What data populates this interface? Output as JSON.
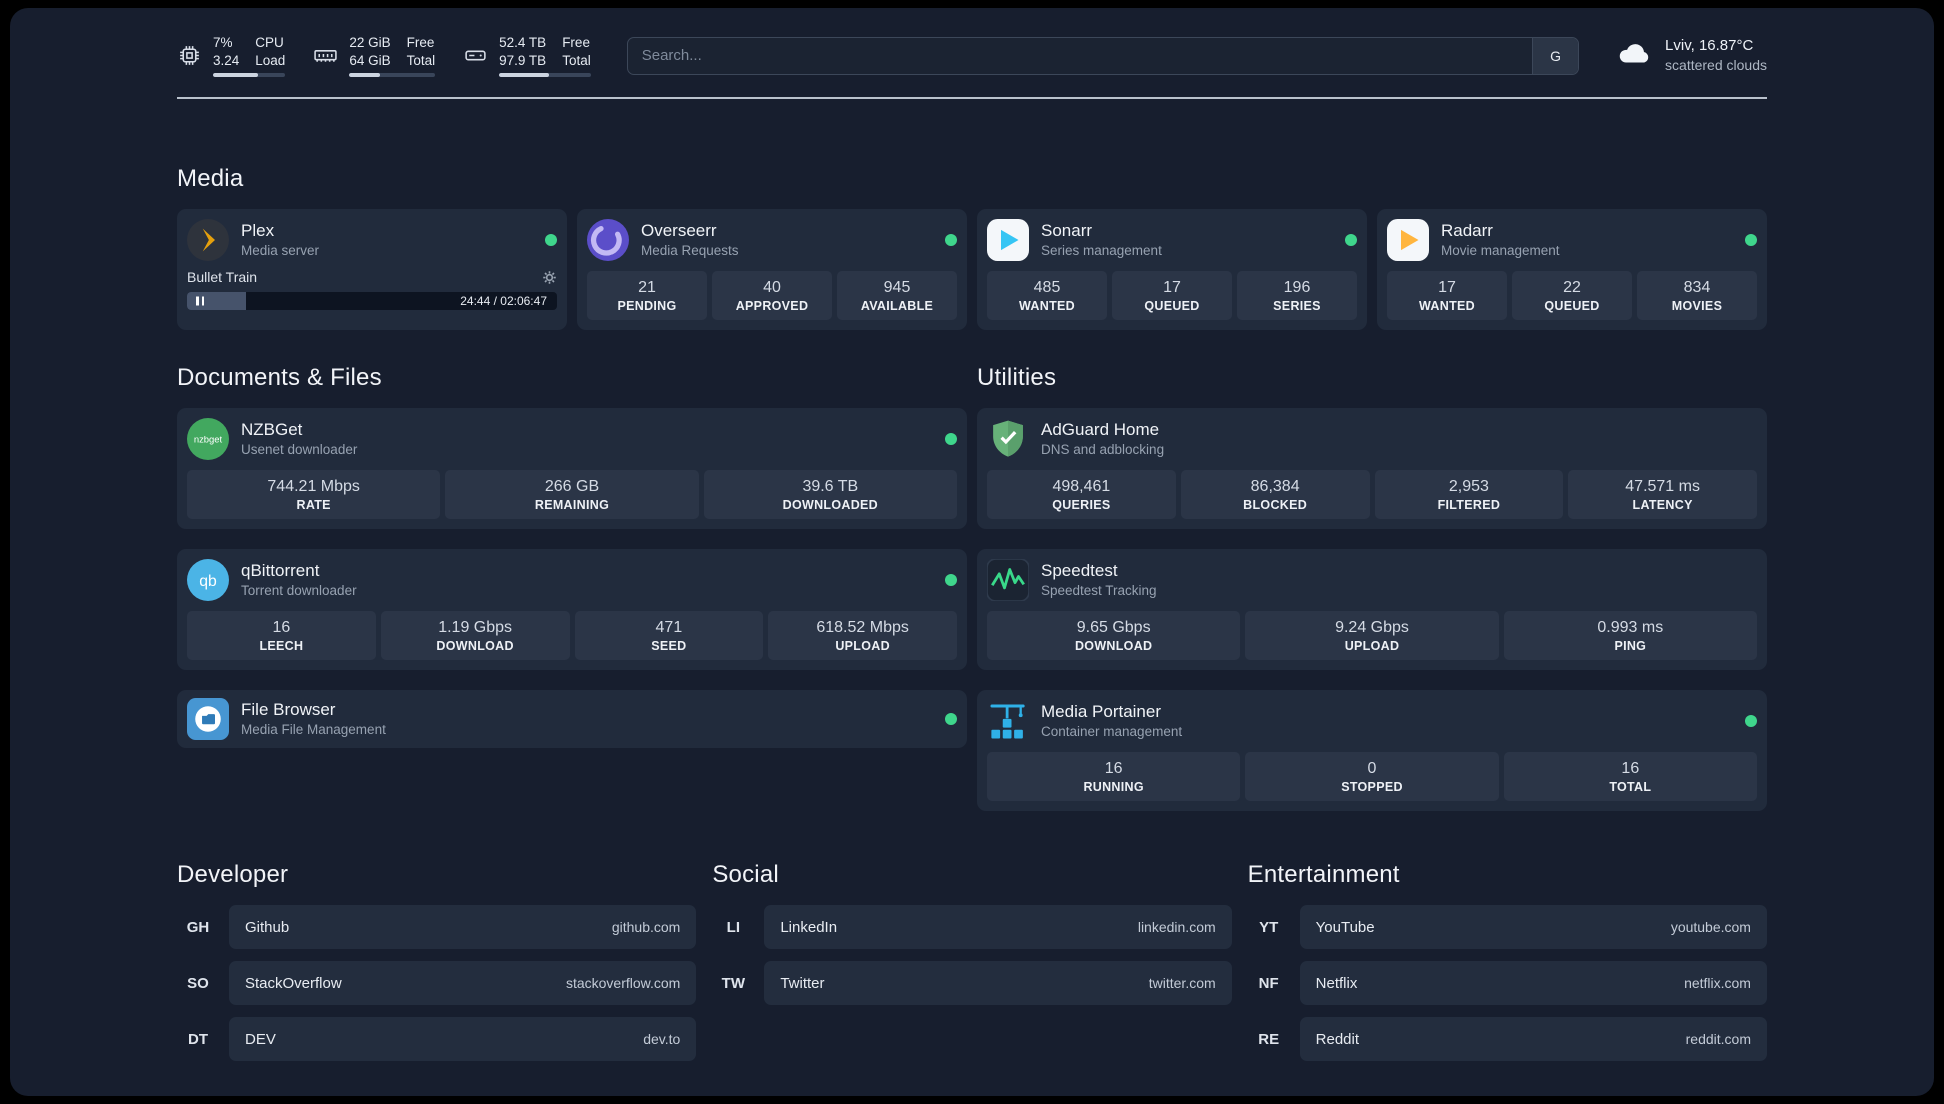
{
  "topbar": {
    "resources": {
      "cpu": {
        "value1": "7%",
        "value2": "3.24",
        "label1": "CPU",
        "label2": "Load",
        "bar_percent": 62
      },
      "memory": {
        "value1": "22 GiB",
        "value2": "64 GiB",
        "label1": "Free",
        "label2": "Total",
        "bar_percent": 36
      },
      "disk": {
        "value1": "52.4 TB",
        "value2": "97.9 TB",
        "label1": "Free",
        "label2": "Total",
        "bar_percent": 54
      }
    },
    "search": {
      "placeholder": "Search...",
      "button_label": "G"
    },
    "weather": {
      "location": "Lviv, 16.87°C",
      "condition": "scattered clouds"
    }
  },
  "sections": {
    "media": {
      "title": "Media",
      "plex": {
        "title": "Plex",
        "subtitle": "Media server",
        "now_playing": "Bullet Train",
        "time": "24:44 / 02:06:47",
        "progress_percent": 16
      },
      "overseerr": {
        "title": "Overseerr",
        "subtitle": "Media Requests",
        "stats": [
          {
            "value": "21",
            "label": "PENDING"
          },
          {
            "value": "40",
            "label": "APPROVED"
          },
          {
            "value": "945",
            "label": "AVAILABLE"
          }
        ]
      },
      "sonarr": {
        "title": "Sonarr",
        "subtitle": "Series management",
        "stats": [
          {
            "value": "485",
            "label": "WANTED"
          },
          {
            "value": "17",
            "label": "QUEUED"
          },
          {
            "value": "196",
            "label": "SERIES"
          }
        ]
      },
      "radarr": {
        "title": "Radarr",
        "subtitle": "Movie management",
        "stats": [
          {
            "value": "17",
            "label": "WANTED"
          },
          {
            "value": "22",
            "label": "QUEUED"
          },
          {
            "value": "834",
            "label": "MOVIES"
          }
        ]
      }
    },
    "documents": {
      "title": "Documents & Files",
      "nzbget": {
        "title": "NZBGet",
        "subtitle": "Usenet downloader",
        "stats": [
          {
            "value": "744.21 Mbps",
            "label": "RATE"
          },
          {
            "value": "266 GB",
            "label": "REMAINING"
          },
          {
            "value": "39.6 TB",
            "label": "DOWNLOADED"
          }
        ]
      },
      "qbittorrent": {
        "title": "qBittorrent",
        "subtitle": "Torrent downloader",
        "stats": [
          {
            "value": "16",
            "label": "LEECH"
          },
          {
            "value": "1.19 Gbps",
            "label": "DOWNLOAD"
          },
          {
            "value": "471",
            "label": "SEED"
          },
          {
            "value": "618.52 Mbps",
            "label": "UPLOAD"
          }
        ]
      },
      "filebrowser": {
        "title": "File Browser",
        "subtitle": "Media File Management"
      }
    },
    "utilities": {
      "title": "Utilities",
      "adguard": {
        "title": "AdGuard Home",
        "subtitle": "DNS and adblocking",
        "stats": [
          {
            "value": "498,461",
            "label": "QUERIES"
          },
          {
            "value": "86,384",
            "label": "BLOCKED"
          },
          {
            "value": "2,953",
            "label": "FILTERED"
          },
          {
            "value": "47.571 ms",
            "label": "LATENCY"
          }
        ]
      },
      "speedtest": {
        "title": "Speedtest",
        "subtitle": "Speedtest Tracking",
        "stats": [
          {
            "value": "9.65 Gbps",
            "label": "DOWNLOAD"
          },
          {
            "value": "9.24 Gbps",
            "label": "UPLOAD"
          },
          {
            "value": "0.993 ms",
            "label": "PING"
          }
        ]
      },
      "portainer": {
        "title": "Media Portainer",
        "subtitle": "Container management",
        "stats": [
          {
            "value": "16",
            "label": "RUNNING"
          },
          {
            "value": "0",
            "label": "STOPPED"
          },
          {
            "value": "16",
            "label": "TOTAL"
          }
        ]
      }
    },
    "developer": {
      "title": "Developer",
      "links": [
        {
          "abbr": "GH",
          "name": "Github",
          "url": "github.com"
        },
        {
          "abbr": "SO",
          "name": "StackOverflow",
          "url": "stackoverflow.com"
        },
        {
          "abbr": "DT",
          "name": "DEV",
          "url": "dev.to"
        }
      ]
    },
    "social": {
      "title": "Social",
      "links": [
        {
          "abbr": "LI",
          "name": "LinkedIn",
          "url": "linkedin.com"
        },
        {
          "abbr": "TW",
          "name": "Twitter",
          "url": "twitter.com"
        }
      ]
    },
    "entertainment": {
      "title": "Entertainment",
      "links": [
        {
          "abbr": "YT",
          "name": "YouTube",
          "url": "youtube.com"
        },
        {
          "abbr": "NF",
          "name": "Netflix",
          "url": "netflix.com"
        },
        {
          "abbr": "RE",
          "name": "Reddit",
          "url": "reddit.com"
        }
      ]
    }
  }
}
